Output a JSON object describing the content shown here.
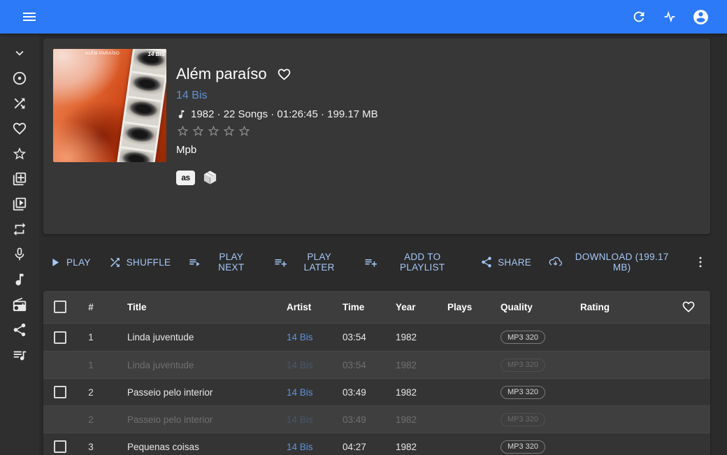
{
  "topbar": {
    "icons": [
      "hamburger-menu-icon",
      "refresh-icon",
      "activity-icon",
      "account-circle-icon"
    ]
  },
  "sidebar": {
    "icons": [
      "chevron-down-icon",
      "album-disc-icon",
      "shuffle-icon",
      "heart-icon",
      "star-icon",
      "library-add-icon",
      "library-play-icon",
      "repeat-icon",
      "microphone-icon",
      "music-note-icon",
      "radio-icon",
      "share-icon",
      "playlist-icon"
    ]
  },
  "album": {
    "title": "Além paraíso",
    "artist": "14 Bis",
    "details": "1982 · 22 Songs · 01:26:45 · 199.17 MB",
    "genre": "Mpb",
    "rating_value": 0,
    "rating_total": 5,
    "cover": {
      "text_left": "ALÉM PARAÍSO",
      "text_right": "14 BIS"
    },
    "badges": {
      "lastfm_label": "as",
      "musicbrainz": "musicbrainz-cube-icon"
    }
  },
  "toolbar": {
    "buttons": [
      {
        "label": "PLAY",
        "icon": "play-icon"
      },
      {
        "label": "SHUFFLE",
        "icon": "shuffle-icon"
      },
      {
        "label": "PLAY NEXT",
        "icon": "playlist-play-icon"
      },
      {
        "label": "PLAY LATER",
        "icon": "playlist-add-icon"
      },
      {
        "label": "ADD TO PLAYLIST",
        "icon": "playlist-add-icon"
      },
      {
        "label": "SHARE",
        "icon": "share-icon"
      },
      {
        "label": "DOWNLOAD (199.17 MB)",
        "icon": "cloud-download-icon"
      }
    ],
    "more_icon": "kebab-menu-icon"
  },
  "table": {
    "headers": {
      "num": "#",
      "title": "Title",
      "artist": "Artist",
      "time": "Time",
      "year": "Year",
      "plays": "Plays",
      "quality": "Quality",
      "rating": "Rating"
    },
    "rows": [
      {
        "num": "1",
        "title": "Linda juventude",
        "artist": "14 Bis",
        "time": "03:54",
        "year": "1982",
        "plays": "",
        "quality": "MP3 320"
      },
      {
        "num": "2",
        "title": "Passeio pelo interior",
        "artist": "14 Bis",
        "time": "03:49",
        "year": "1982",
        "plays": "",
        "quality": "MP3 320"
      },
      {
        "num": "3",
        "title": "Pequenas coisas",
        "artist": "14 Bis",
        "time": "04:27",
        "year": "1982",
        "plays": "",
        "quality": "MP3 320"
      }
    ]
  },
  "colors": {
    "accent_blue": "#2d7af8",
    "artist_link": "#6192cf",
    "row_link": "#5f92d8",
    "toolbar_button": "#a6c8f7",
    "card_bg": "#373737",
    "row_bg": "#343434",
    "ghost_row_bg": "#3f3f3f"
  }
}
